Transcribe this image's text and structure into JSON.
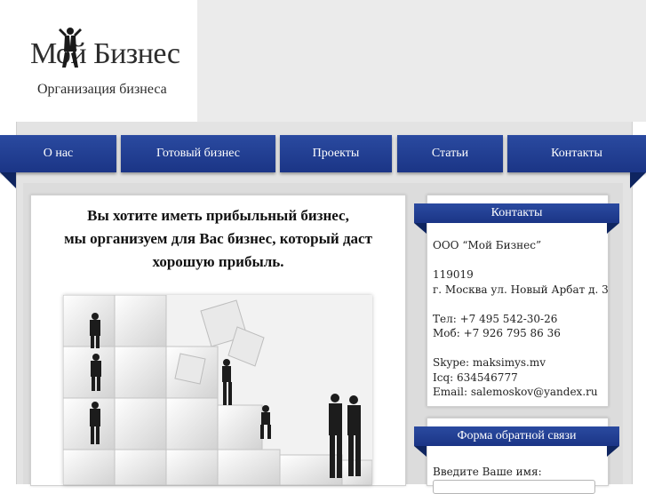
{
  "logo": {
    "title": "Мой Бизнес",
    "subtitle": "Организация бизнеса"
  },
  "nav": {
    "items": [
      {
        "label": "О нас"
      },
      {
        "label": "Готовый бизнес"
      },
      {
        "label": "Проекты"
      },
      {
        "label": "Статьи"
      },
      {
        "label": "Контакты"
      }
    ]
  },
  "main": {
    "headline": [
      "Вы хотите иметь прибыльный бизнес,",
      "мы организуем для Вас бизнес, который даст",
      "хорошую прибыль."
    ],
    "image_subject": "puzzle-teamwork-illustration"
  },
  "contacts": {
    "title": "Контакты",
    "lines": [
      "ООО “Мой Бизнес”",
      "",
      "119019",
      "г. Москва ул. Новый Арбат д. 3",
      "",
      "Тел: +7 495 542-30-26",
      "Моб: +7 926 795 86 36",
      "",
      "Skype: maksimys.mv",
      "Icq: 634546777",
      "Email: salemoskov@yandex.ru"
    ]
  },
  "feedback": {
    "title": "Форма обратной связи",
    "name_label": "Введите Ваше имя:",
    "name_value": ""
  },
  "colors": {
    "nav_blue": "#1f3d94",
    "nav_dark": "#0f2560",
    "band_gray": "#ebebeb"
  }
}
